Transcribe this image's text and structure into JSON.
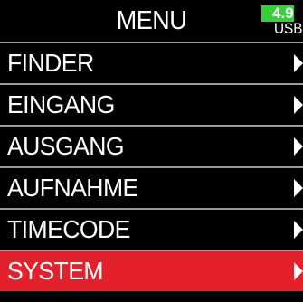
{
  "header": {
    "title": "MENU",
    "battery": {
      "level": "4.9",
      "source": "USB",
      "color": "#36d13a"
    }
  },
  "menu": {
    "items": [
      {
        "label": "FINDER",
        "icon": "chevron-right-icon",
        "selected": false
      },
      {
        "label": "EINGANG",
        "icon": "chevron-right-icon",
        "selected": false
      },
      {
        "label": "AUSGANG",
        "icon": "chevron-right-icon",
        "selected": false
      },
      {
        "label": "AUFNAHME",
        "icon": "chevron-right-icon",
        "selected": false
      },
      {
        "label": "TIMECODE",
        "icon": "chevron-right-icon",
        "selected": false
      },
      {
        "label": "SYSTEM",
        "icon": "chevron-right-icon",
        "selected": true
      }
    ],
    "selected_color": "#e4202a",
    "divider_color": "#9a9a9a"
  }
}
